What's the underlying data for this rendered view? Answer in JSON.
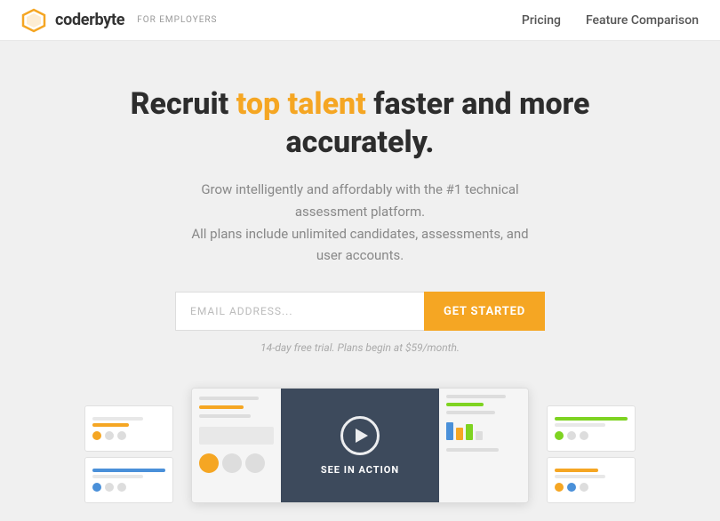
{
  "nav": {
    "brand": "coderbyte",
    "brand_suffix": "FOR EMPLOYERS",
    "links": [
      {
        "label": "Pricing",
        "id": "pricing"
      },
      {
        "label": "Feature Comparison",
        "id": "feature-comparison"
      }
    ]
  },
  "hero": {
    "title_before": "Recruit ",
    "title_highlight": "top talent",
    "title_after": " faster and more accurately.",
    "subtitle_line1": "Grow intelligently and affordably with the #1 technical",
    "subtitle_line2": "assessment platform.",
    "subtitle_line3": "All plans include unlimited candidates, assessments, and",
    "subtitle_line4": "user accounts.",
    "email_placeholder": "EMAIL ADDRESS...",
    "cta_button": "GET STARTED",
    "trial_text": "14-day free trial. Plans begin at $59/month."
  },
  "video": {
    "label": "SEE IN ACTION"
  }
}
